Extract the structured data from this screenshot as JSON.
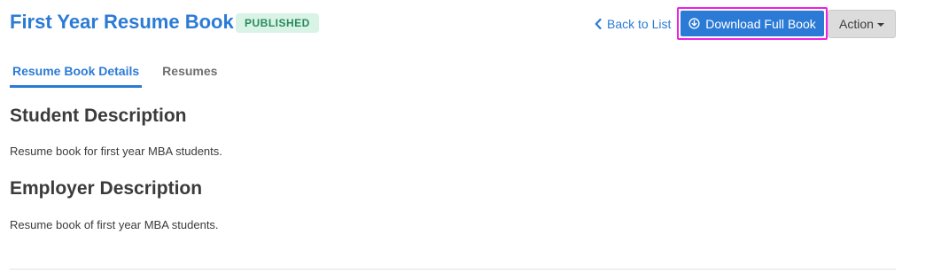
{
  "header": {
    "title": "First Year Resume Book",
    "status_badge": "PUBLISHED",
    "back_link": "Back to List",
    "download_button": "Download Full Book",
    "action_button": "Action"
  },
  "tabs": [
    {
      "label": "Resume Book Details",
      "active": true
    },
    {
      "label": "Resumes",
      "active": false
    }
  ],
  "sections": {
    "student": {
      "heading": "Student Description",
      "text": "Resume book for first year MBA students."
    },
    "employer": {
      "heading": "Employer Description",
      "text": "Resume book of first year MBA students."
    }
  },
  "icons": {
    "back": "chevron-left-icon",
    "download": "download-circle-icon",
    "action": "caret-down-icon"
  },
  "colors": {
    "primary": "#2b7bd6",
    "badge_bg": "#d9f3e6",
    "badge_text": "#2a8a5b",
    "highlight_border": "#ee1fe6"
  }
}
